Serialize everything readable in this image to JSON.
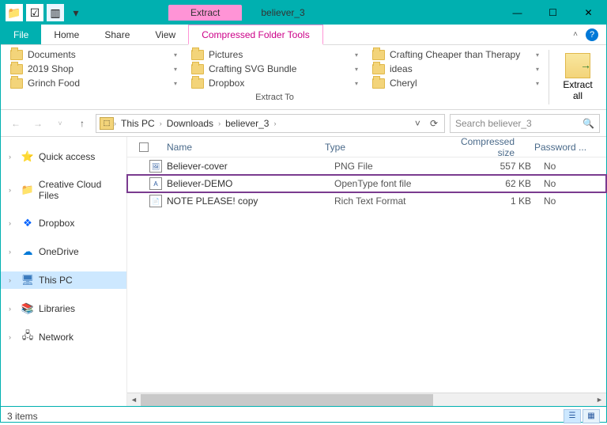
{
  "window": {
    "title": "believer_3",
    "contextual_tab_header": "Extract"
  },
  "tabs": {
    "file": "File",
    "home": "Home",
    "share": "Share",
    "view": "View",
    "ctx": "Compressed Folder Tools"
  },
  "ribbon": {
    "locations": [
      {
        "label": "Documents"
      },
      {
        "label": "2019 Shop"
      },
      {
        "label": "Grinch Food"
      },
      {
        "label": "Pictures"
      },
      {
        "label": "Crafting SVG Bundle"
      },
      {
        "label": "Dropbox"
      },
      {
        "label": "Crafting Cheaper than Therapy"
      },
      {
        "label": "ideas"
      },
      {
        "label": "Cheryl"
      }
    ],
    "group_label": "Extract To",
    "extract_all": "Extract\nall"
  },
  "breadcrumb": {
    "parts": [
      "This PC",
      "Downloads",
      "believer_3"
    ]
  },
  "search": {
    "placeholder": "Search believer_3"
  },
  "navpane": [
    {
      "label": "Quick access",
      "icon": "⭐",
      "color": "#f5b942"
    },
    {
      "label": "Creative Cloud Files",
      "icon": "📁",
      "color": "#333"
    },
    {
      "label": "Dropbox",
      "icon": "❖",
      "color": "#0061fe"
    },
    {
      "label": "OneDrive",
      "icon": "☁",
      "color": "#0078d7"
    },
    {
      "label": "This PC",
      "icon": "🖥",
      "color": "#3a7abd",
      "selected": true
    },
    {
      "label": "Libraries",
      "icon": "📚",
      "color": "#c9a84a"
    },
    {
      "label": "Network",
      "icon": "🖧",
      "color": "#555"
    }
  ],
  "columns": {
    "name": "Name",
    "type": "Type",
    "csize": "Compressed size",
    "pwd": "Password ..."
  },
  "files": [
    {
      "name": "Believer-cover",
      "type": "PNG File",
      "csize": "557 KB",
      "pwd": "No",
      "ico": "🖼"
    },
    {
      "name": "Believer-DEMO",
      "type": "OpenType font file",
      "csize": "62 KB",
      "pwd": "No",
      "highlighted": true,
      "ico": "A"
    },
    {
      "name": "NOTE PLEASE! copy",
      "type": "Rich Text Format",
      "csize": "1 KB",
      "pwd": "No",
      "ico": "📄"
    }
  ],
  "status": {
    "items": "3 items"
  }
}
